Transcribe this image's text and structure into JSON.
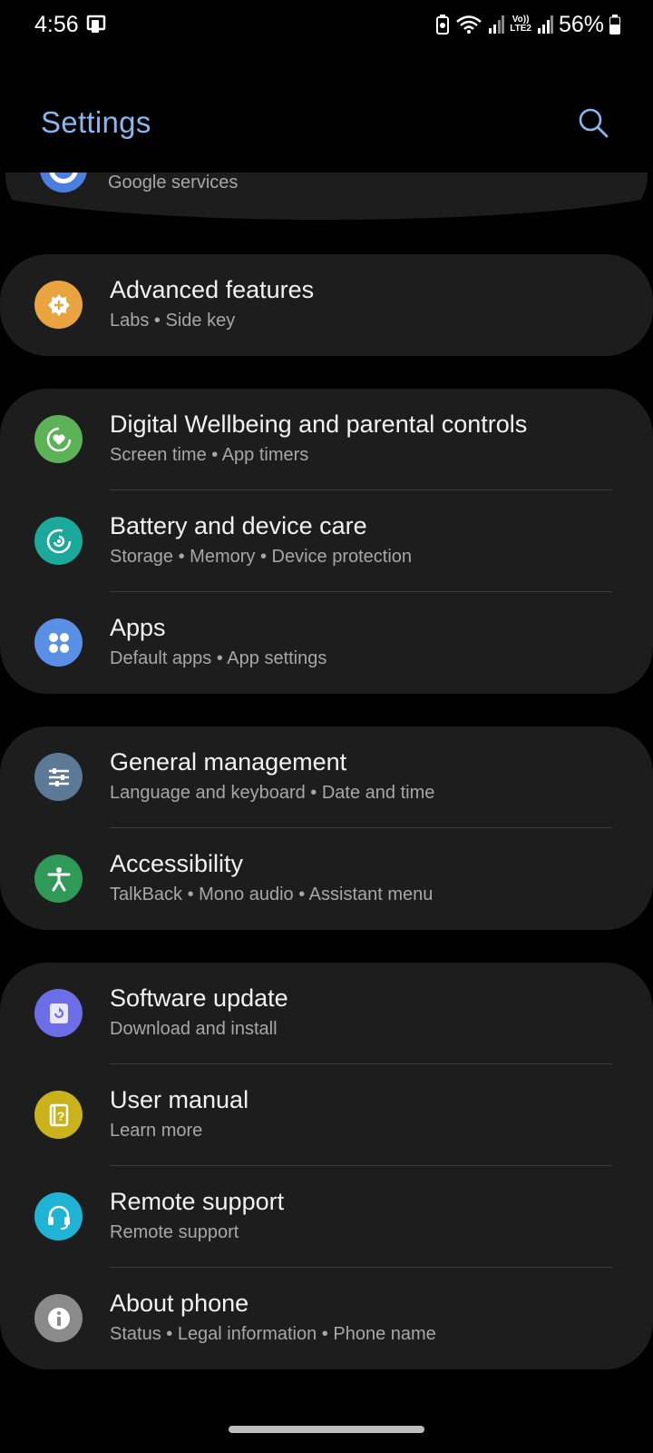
{
  "status_bar": {
    "time": "4:56",
    "battery_percent": "56%",
    "lte_label_top": "Vo))",
    "lte_label_bottom": "LTE2"
  },
  "header": {
    "title": "Settings",
    "search_icon": "search-icon"
  },
  "partial_item": {
    "subtitle": "Google services",
    "icon": "google-icon",
    "icon_color": "#4a7fe0"
  },
  "cards": [
    {
      "items": [
        {
          "title": "Advanced features",
          "subtitle": "Labs  •  Side key",
          "icon": "advanced-features-icon",
          "icon_color": "#e9a440"
        }
      ]
    },
    {
      "items": [
        {
          "title": "Digital Wellbeing and parental controls",
          "subtitle": "Screen time  •  App timers",
          "icon": "digital-wellbeing-icon",
          "icon_color": "#5bb257"
        },
        {
          "title": "Battery and device care",
          "subtitle": "Storage  •  Memory  •  Device protection",
          "icon": "device-care-icon",
          "icon_color": "#1aa99a"
        },
        {
          "title": "Apps",
          "subtitle": "Default apps  •  App settings",
          "icon": "apps-icon",
          "icon_color": "#5a8fe6"
        }
      ]
    },
    {
      "items": [
        {
          "title": "General management",
          "subtitle": "Language and keyboard  •  Date and time",
          "icon": "general-management-icon",
          "icon_color": "#5c7a95"
        },
        {
          "title": "Accessibility",
          "subtitle": "TalkBack  •  Mono audio  •  Assistant menu",
          "icon": "accessibility-icon",
          "icon_color": "#2f9a57"
        }
      ]
    },
    {
      "items": [
        {
          "title": "Software update",
          "subtitle": "Download and install",
          "icon": "software-update-icon",
          "icon_color": "#6b6ee6"
        },
        {
          "title": "User manual",
          "subtitle": "Learn more",
          "icon": "user-manual-icon",
          "icon_color": "#c9b21a"
        },
        {
          "title": "Remote support",
          "subtitle": "Remote support",
          "icon": "remote-support-icon",
          "icon_color": "#1fb4d6"
        },
        {
          "title": "About phone",
          "subtitle": "Status  •  Legal information  •  Phone name",
          "icon": "about-phone-icon",
          "icon_color": "#8a8a8a"
        }
      ]
    }
  ]
}
